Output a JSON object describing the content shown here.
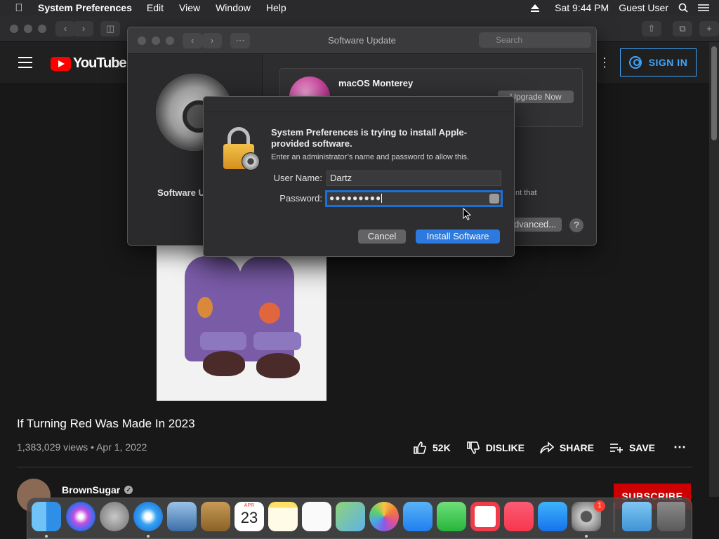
{
  "menubar": {
    "app_name": "System Preferences",
    "menus": [
      "Edit",
      "View",
      "Window",
      "Help"
    ],
    "clock": "Sat 9:44 PM",
    "user": "Guest User"
  },
  "youtube": {
    "logo_text": "YouTube",
    "sign_in": "SIGN IN",
    "video_title": "If Turning Red Was Made In 2023",
    "video_meta": "1,383,029 views • Apr 1, 2022",
    "likes": "52K",
    "dislike": "DISLIKE",
    "share": "SHARE",
    "save": "SAVE",
    "channel": "BrownSugar",
    "subscribe": "SUBSCRIBE"
  },
  "software_update": {
    "title": "Software Update",
    "search_placeholder": "Search",
    "sidebar_label": "Software Update",
    "update_name": "macOS Monterey",
    "upgrade_button": "Upgrade Now",
    "side_text": "nt that",
    "advanced_button": "Advanced...",
    "help": "?"
  },
  "auth_dialog": {
    "heading": "System Preferences is trying to install Apple-provided software.",
    "subtext": "Enter an administrator’s name and password to allow this.",
    "username_label": "User Name:",
    "username_value": "Dartz",
    "password_label": "Password:",
    "password_value": "●●●●●●●●●",
    "cancel": "Cancel",
    "install": "Install Software"
  },
  "dock": {
    "calendar_month": "APR",
    "calendar_day": "23",
    "sysprefs_badge": "1",
    "icons": [
      "finder-icon",
      "siri-icon",
      "launchpad-icon",
      "safari-icon",
      "mail-icon",
      "contacts-icon",
      "calendar-icon",
      "notes-icon",
      "reminders-icon",
      "maps-icon",
      "photos-icon",
      "messages-icon",
      "facetime-icon",
      "news-icon",
      "music-icon",
      "app-store-icon",
      "system-preferences-icon",
      "downloads-folder-icon",
      "trash-icon"
    ]
  },
  "colors": {
    "accent_blue": "#2c79e0",
    "youtube_red": "#ff0000",
    "focus_ring": "#1b6fd6"
  }
}
